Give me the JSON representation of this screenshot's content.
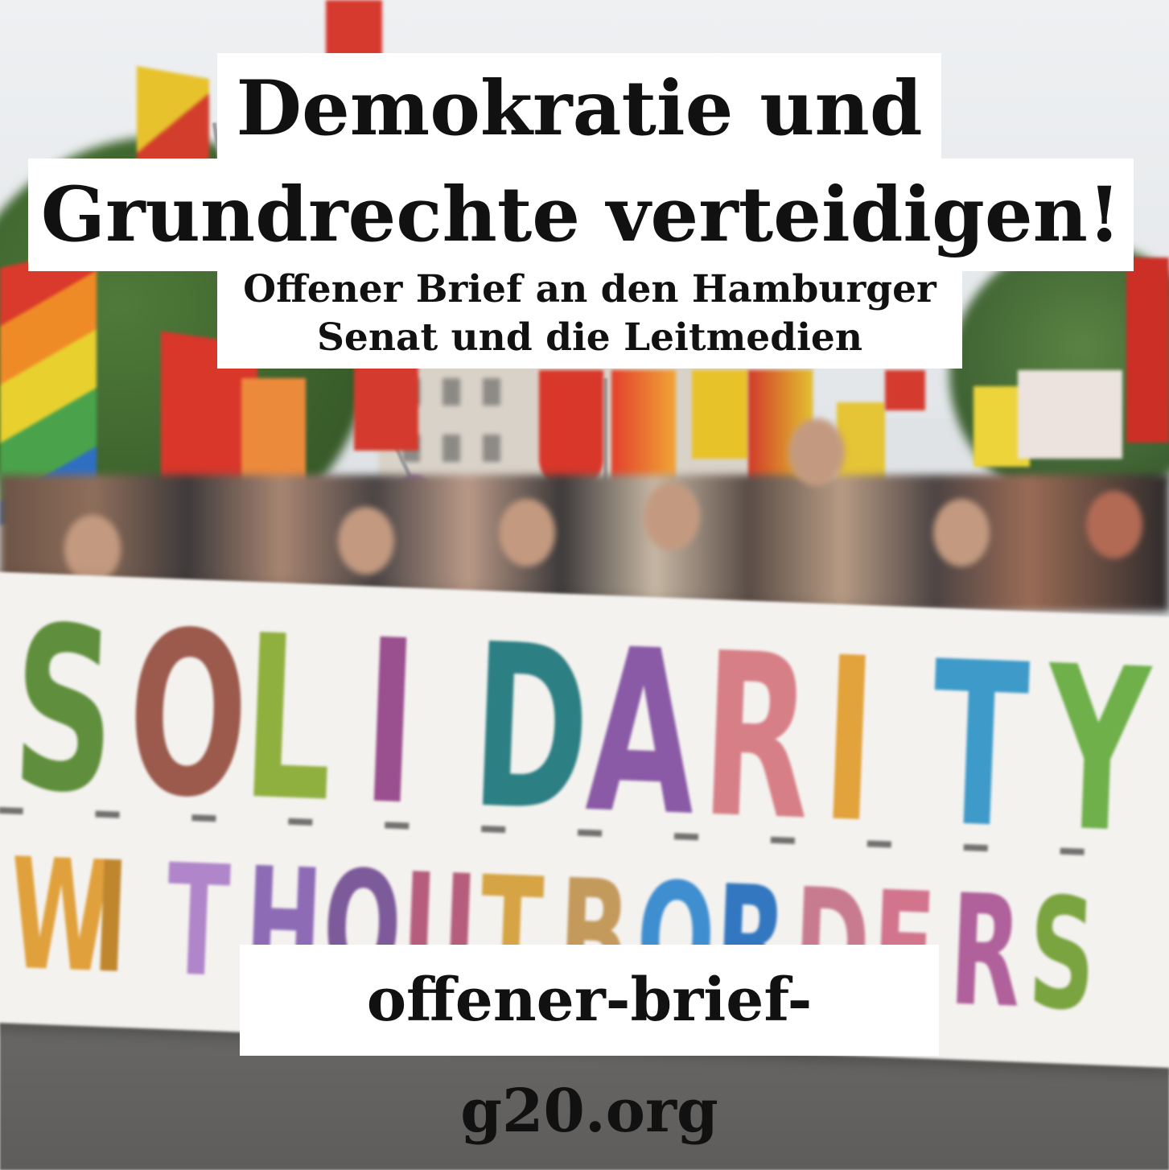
{
  "headline": {
    "line1": "Demokratie und",
    "line2": "Grundrechte verteidigen!"
  },
  "subheadline": {
    "line1": "Offener Brief an den Hamburger",
    "line2": "Senat und die Leitmedien"
  },
  "url": "offener-brief-g20.org",
  "photo": {
    "banner_line1": [
      "S",
      "O",
      "L",
      "I",
      "D",
      "A",
      "R",
      "I",
      "T",
      "Y"
    ],
    "banner_line1_colors": [
      "#5f8f3c",
      "#9b5a4c",
      "#8fb03f",
      "#9a4f8e",
      "#2c7f83",
      "#8a5aa6",
      "#d77f86",
      "#e2a23c",
      "#3d9ac9",
      "#6fb04a"
    ],
    "banner_line2": [
      "W",
      "I",
      "T",
      "H",
      "O",
      "U",
      "T",
      "B",
      "O",
      "R",
      "D",
      "E",
      "R",
      "S"
    ],
    "banner_line2_colors": [
      "#e0a13c",
      "#c0862e",
      "#b085c9",
      "#8e6bb5",
      "#7d5a9a",
      "#b65c7c",
      "#d6a444",
      "#c49a5c",
      "#3f8ed0",
      "#3277c0",
      "#c87b8f",
      "#d1748c",
      "#b0609a",
      "#7aa43f"
    ]
  }
}
